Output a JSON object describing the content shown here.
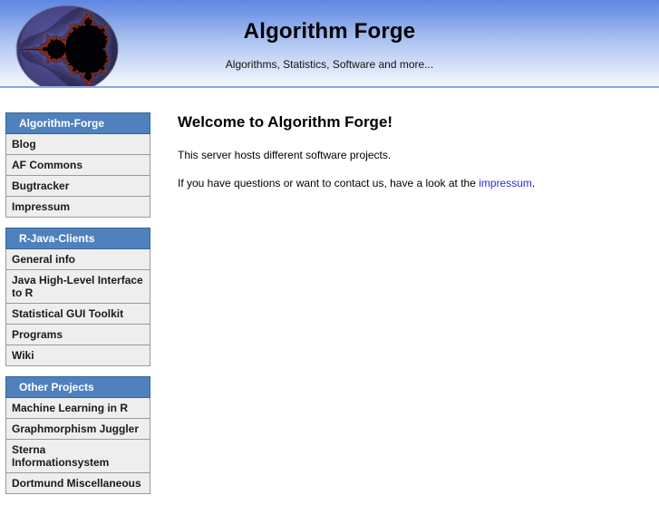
{
  "banner": {
    "logo_icon": "mandelbrot-fractal-logo",
    "title": "Algorithm Forge",
    "subtitle": "Algorithms, Statistics, Software and more..."
  },
  "sidebar": {
    "blocks": [
      {
        "title": "Algorithm-Forge",
        "items": [
          {
            "label": "Blog"
          },
          {
            "label": "AF Commons"
          },
          {
            "label": "Bugtracker"
          },
          {
            "label": "Impressum"
          }
        ]
      },
      {
        "title": "R-Java-Clients",
        "items": [
          {
            "label": "General info"
          },
          {
            "label": "Java High-Level Interface to R"
          },
          {
            "label": "Statistical GUI Toolkit"
          },
          {
            "label": "Programs"
          },
          {
            "label": "Wiki"
          }
        ]
      },
      {
        "title": "Other Projects",
        "items": [
          {
            "label": "Machine Learning in R"
          },
          {
            "label": "Graphmorphism Juggler"
          },
          {
            "label": "Sterna Informationsystem"
          },
          {
            "label": "Dortmund Miscellaneous"
          }
        ]
      }
    ]
  },
  "main": {
    "heading": "Welcome to Algorithm Forge!",
    "paragraph_1": "This server hosts different software projects.",
    "paragraph_2_before": "If you have questions or want to contact us, have a look at the ",
    "paragraph_2_link": "impressum",
    "paragraph_2_after": "."
  },
  "colors": {
    "menu_header_blue": "#4f81bd",
    "banner_blue": "#5f86e0",
    "link_blue": "#2b2bd4",
    "menu_item_bg": "#eeeeee"
  }
}
